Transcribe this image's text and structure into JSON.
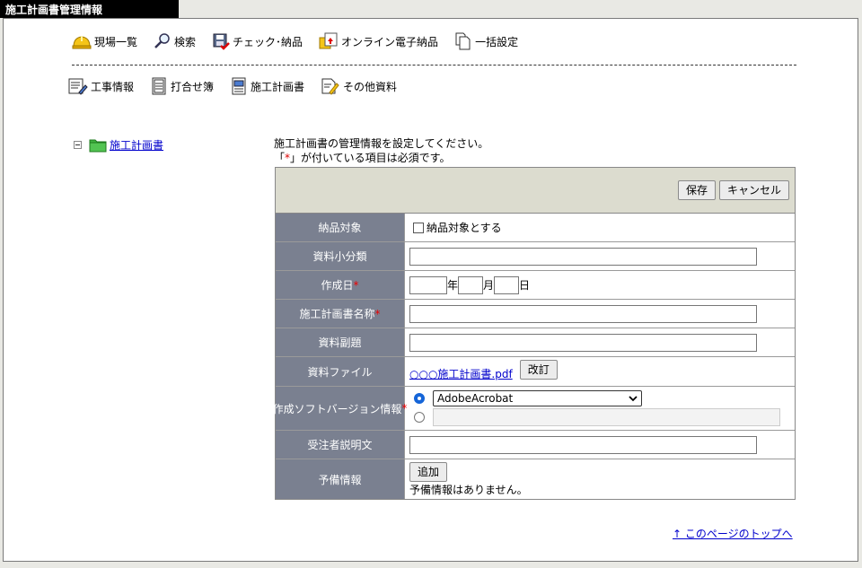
{
  "window": {
    "title": "施工計画書管理情報"
  },
  "nav_primary": [
    {
      "label": "現場一覧",
      "icon": "hardhat-icon"
    },
    {
      "label": "検索",
      "icon": "magnifier-icon"
    },
    {
      "label": "チェック･納品",
      "icon": "floppy-check-icon"
    },
    {
      "label": "オンライン電子納品",
      "icon": "online-delivery-icon"
    },
    {
      "label": "一括設定",
      "icon": "copy-documents-icon"
    }
  ],
  "nav_secondary": [
    {
      "label": "工事情報",
      "icon": "construction-info-icon"
    },
    {
      "label": "打合せ簿",
      "icon": "meeting-record-icon"
    },
    {
      "label": "施工計画書",
      "icon": "construction-plan-icon"
    },
    {
      "label": "その他資料",
      "icon": "other-docs-icon"
    }
  ],
  "tree": {
    "toggle": "−",
    "folder_label": "施工計画書"
  },
  "intro": {
    "line1": "施工計画書の管理情報を設定してください。",
    "line2_prefix": "「",
    "line2_mark": "*",
    "line2_suffix": "」が付いている項目は必須です。"
  },
  "form": {
    "save_label": "保存",
    "cancel_label": "キャンセル",
    "required_mark": "*",
    "fields": {
      "delivery": {
        "label": "納品対象",
        "checkbox_label": "納品対象とする",
        "checked": false
      },
      "subcategory": {
        "label": "資料小分類",
        "value": ""
      },
      "date": {
        "label": "作成日",
        "year": "",
        "year_unit": "年",
        "month": "",
        "month_unit": "月",
        "day": "",
        "day_unit": "日"
      },
      "plan_name": {
        "label": "施工計画書名称",
        "value": ""
      },
      "subtitle": {
        "label": "資料副題",
        "value": ""
      },
      "file": {
        "label": "資料ファイル",
        "filename": "○○○施工計画書.pdf",
        "revise_label": "改訂"
      },
      "software": {
        "label": "作成ソフトバージョン情報",
        "selected": "AdobeAcrobat",
        "other_value": ""
      },
      "contractor_desc": {
        "label": "受注者説明文",
        "value": ""
      },
      "reserve": {
        "label": "予備情報",
        "add_label": "追加",
        "empty_text": "予備情報はありません。"
      }
    }
  },
  "footer": {
    "top_link": "↑ このページのトップへ"
  }
}
